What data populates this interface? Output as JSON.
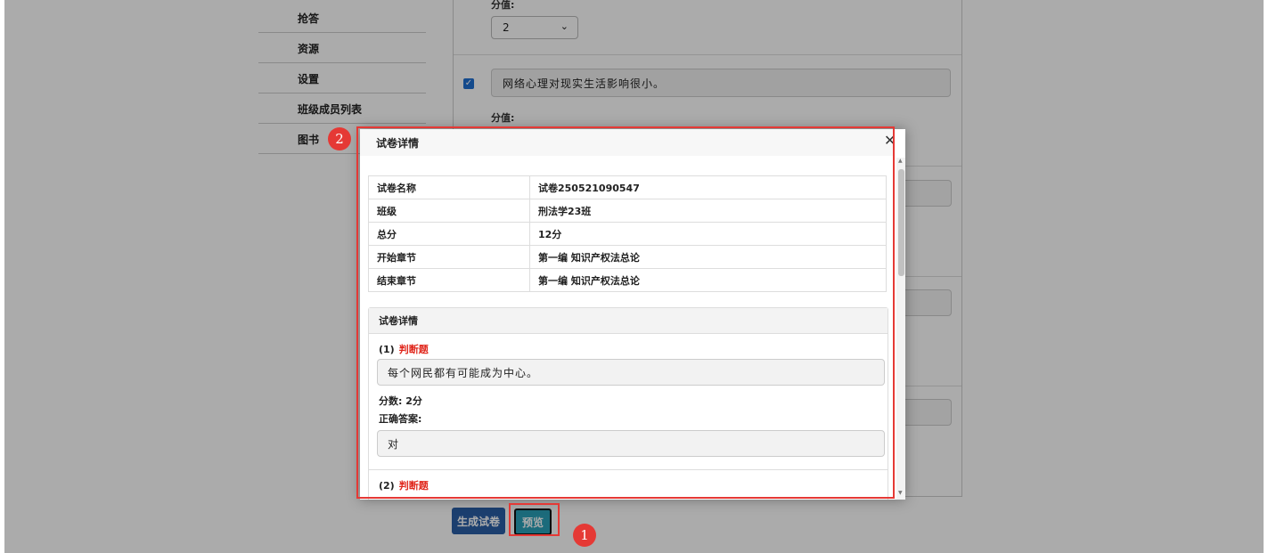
{
  "nav": {
    "items": [
      "抢答",
      "资源",
      "设置",
      "班级成员列表",
      "图书"
    ]
  },
  "background_form": {
    "score_label": "分值:",
    "score_value": "2",
    "checked_statement": "网络心理对现实生活影响很小。",
    "score_label_2": "分值:"
  },
  "actions": {
    "generate_label": "生成试卷",
    "preview_label": "预览"
  },
  "modal": {
    "title": "试卷详情",
    "info_rows": [
      {
        "key": "试卷名称",
        "value": "试卷250521090547"
      },
      {
        "key": "班级",
        "value": "刑法学23班"
      },
      {
        "key": "总分",
        "value": "12分"
      },
      {
        "key": "开始章节",
        "value": "第一编 知识产权法总论"
      },
      {
        "key": "结束章节",
        "value": "第一编 知识产权法总论"
      }
    ],
    "panel_title": "试卷详情",
    "questions": [
      {
        "index": "(1)",
        "type": "判断题",
        "text": "每个网民都有可能成为中心。",
        "score": "分数: 2分",
        "answer_label": "正确答案:",
        "answer": "对"
      },
      {
        "index": "(2)",
        "type": "判断题"
      }
    ]
  },
  "annotations": {
    "badge_1": "1",
    "badge_2": "2",
    "color": "#e53935"
  },
  "colors": {
    "primary_button": "#2b5ea6",
    "preview_button": "#2aa0b8",
    "question_type": "#e0261b"
  }
}
